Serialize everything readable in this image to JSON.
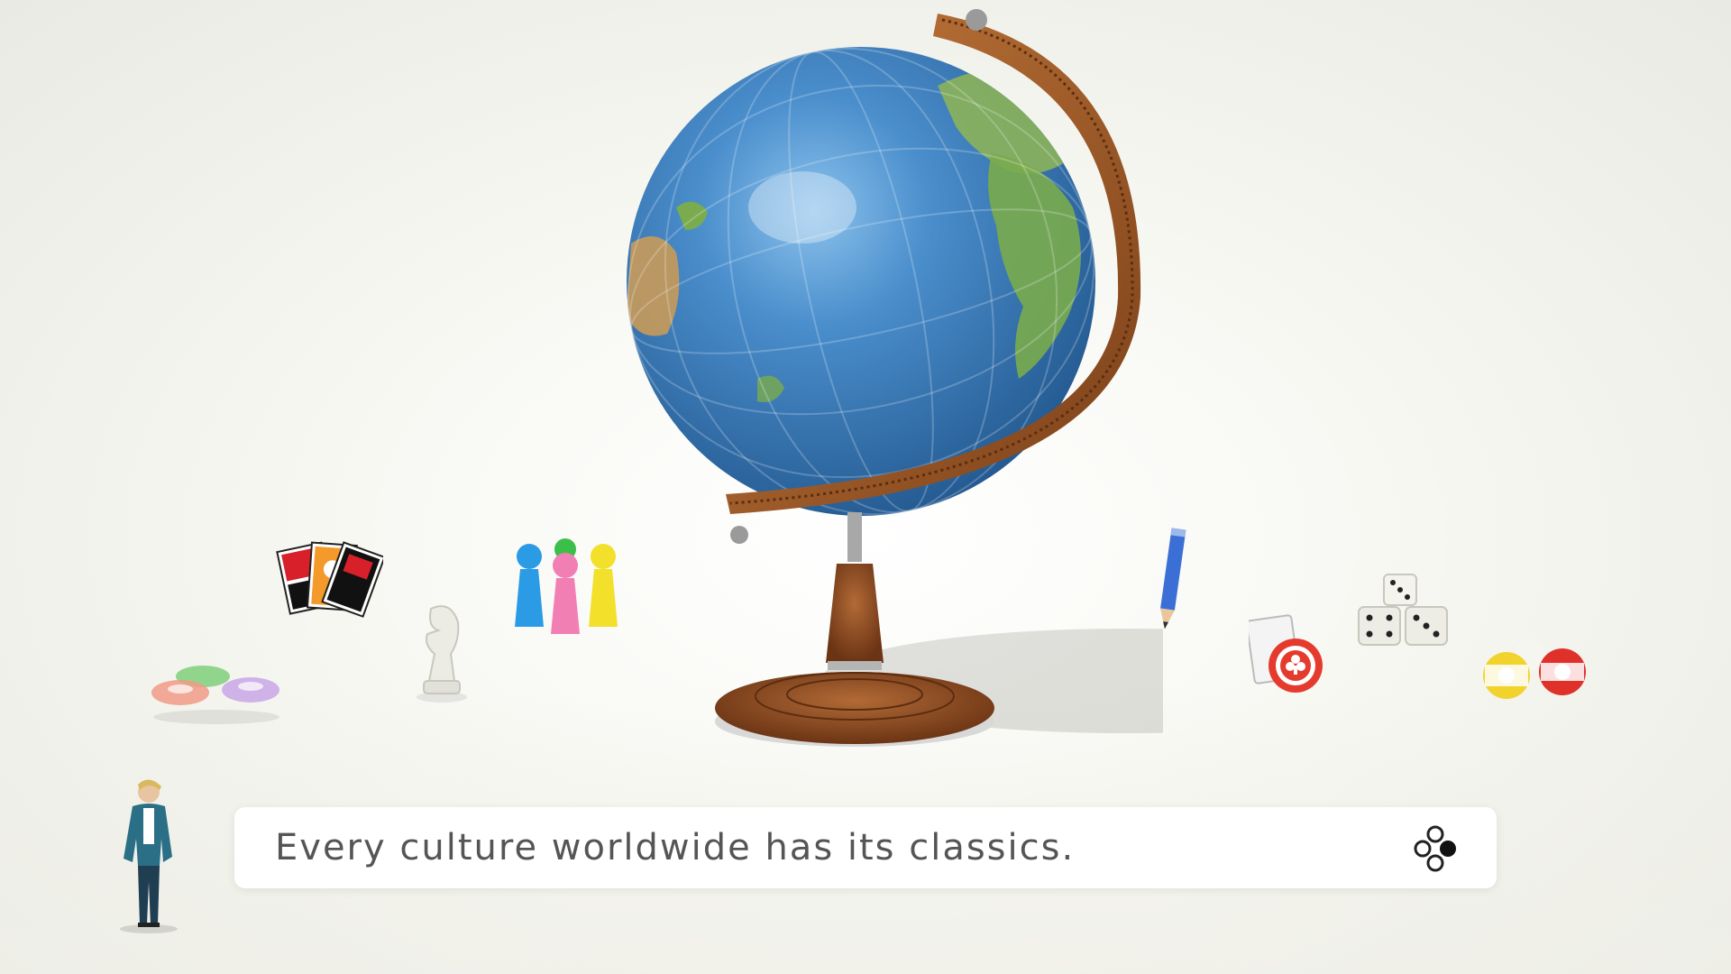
{
  "dialog": {
    "message": "Every culture worldwide has its classics."
  },
  "buttons": {
    "advance_icon": "a-button-icon"
  },
  "props": {
    "centerpiece": "globe-icon",
    "items": [
      "marbles-icon",
      "hanafuda-cards-icon",
      "chess-knight-icon",
      "pawns-icon",
      "pencil-icon",
      "poker-chip-icon",
      "dice-icon",
      "billiard-balls-icon",
      "host-figure-icon"
    ]
  },
  "colors": {
    "ocean": "#3f84c4",
    "land": "#7aab4e",
    "wood": "#9a5a2c",
    "dialog_bg": "#ffffff",
    "text": "#555555"
  }
}
